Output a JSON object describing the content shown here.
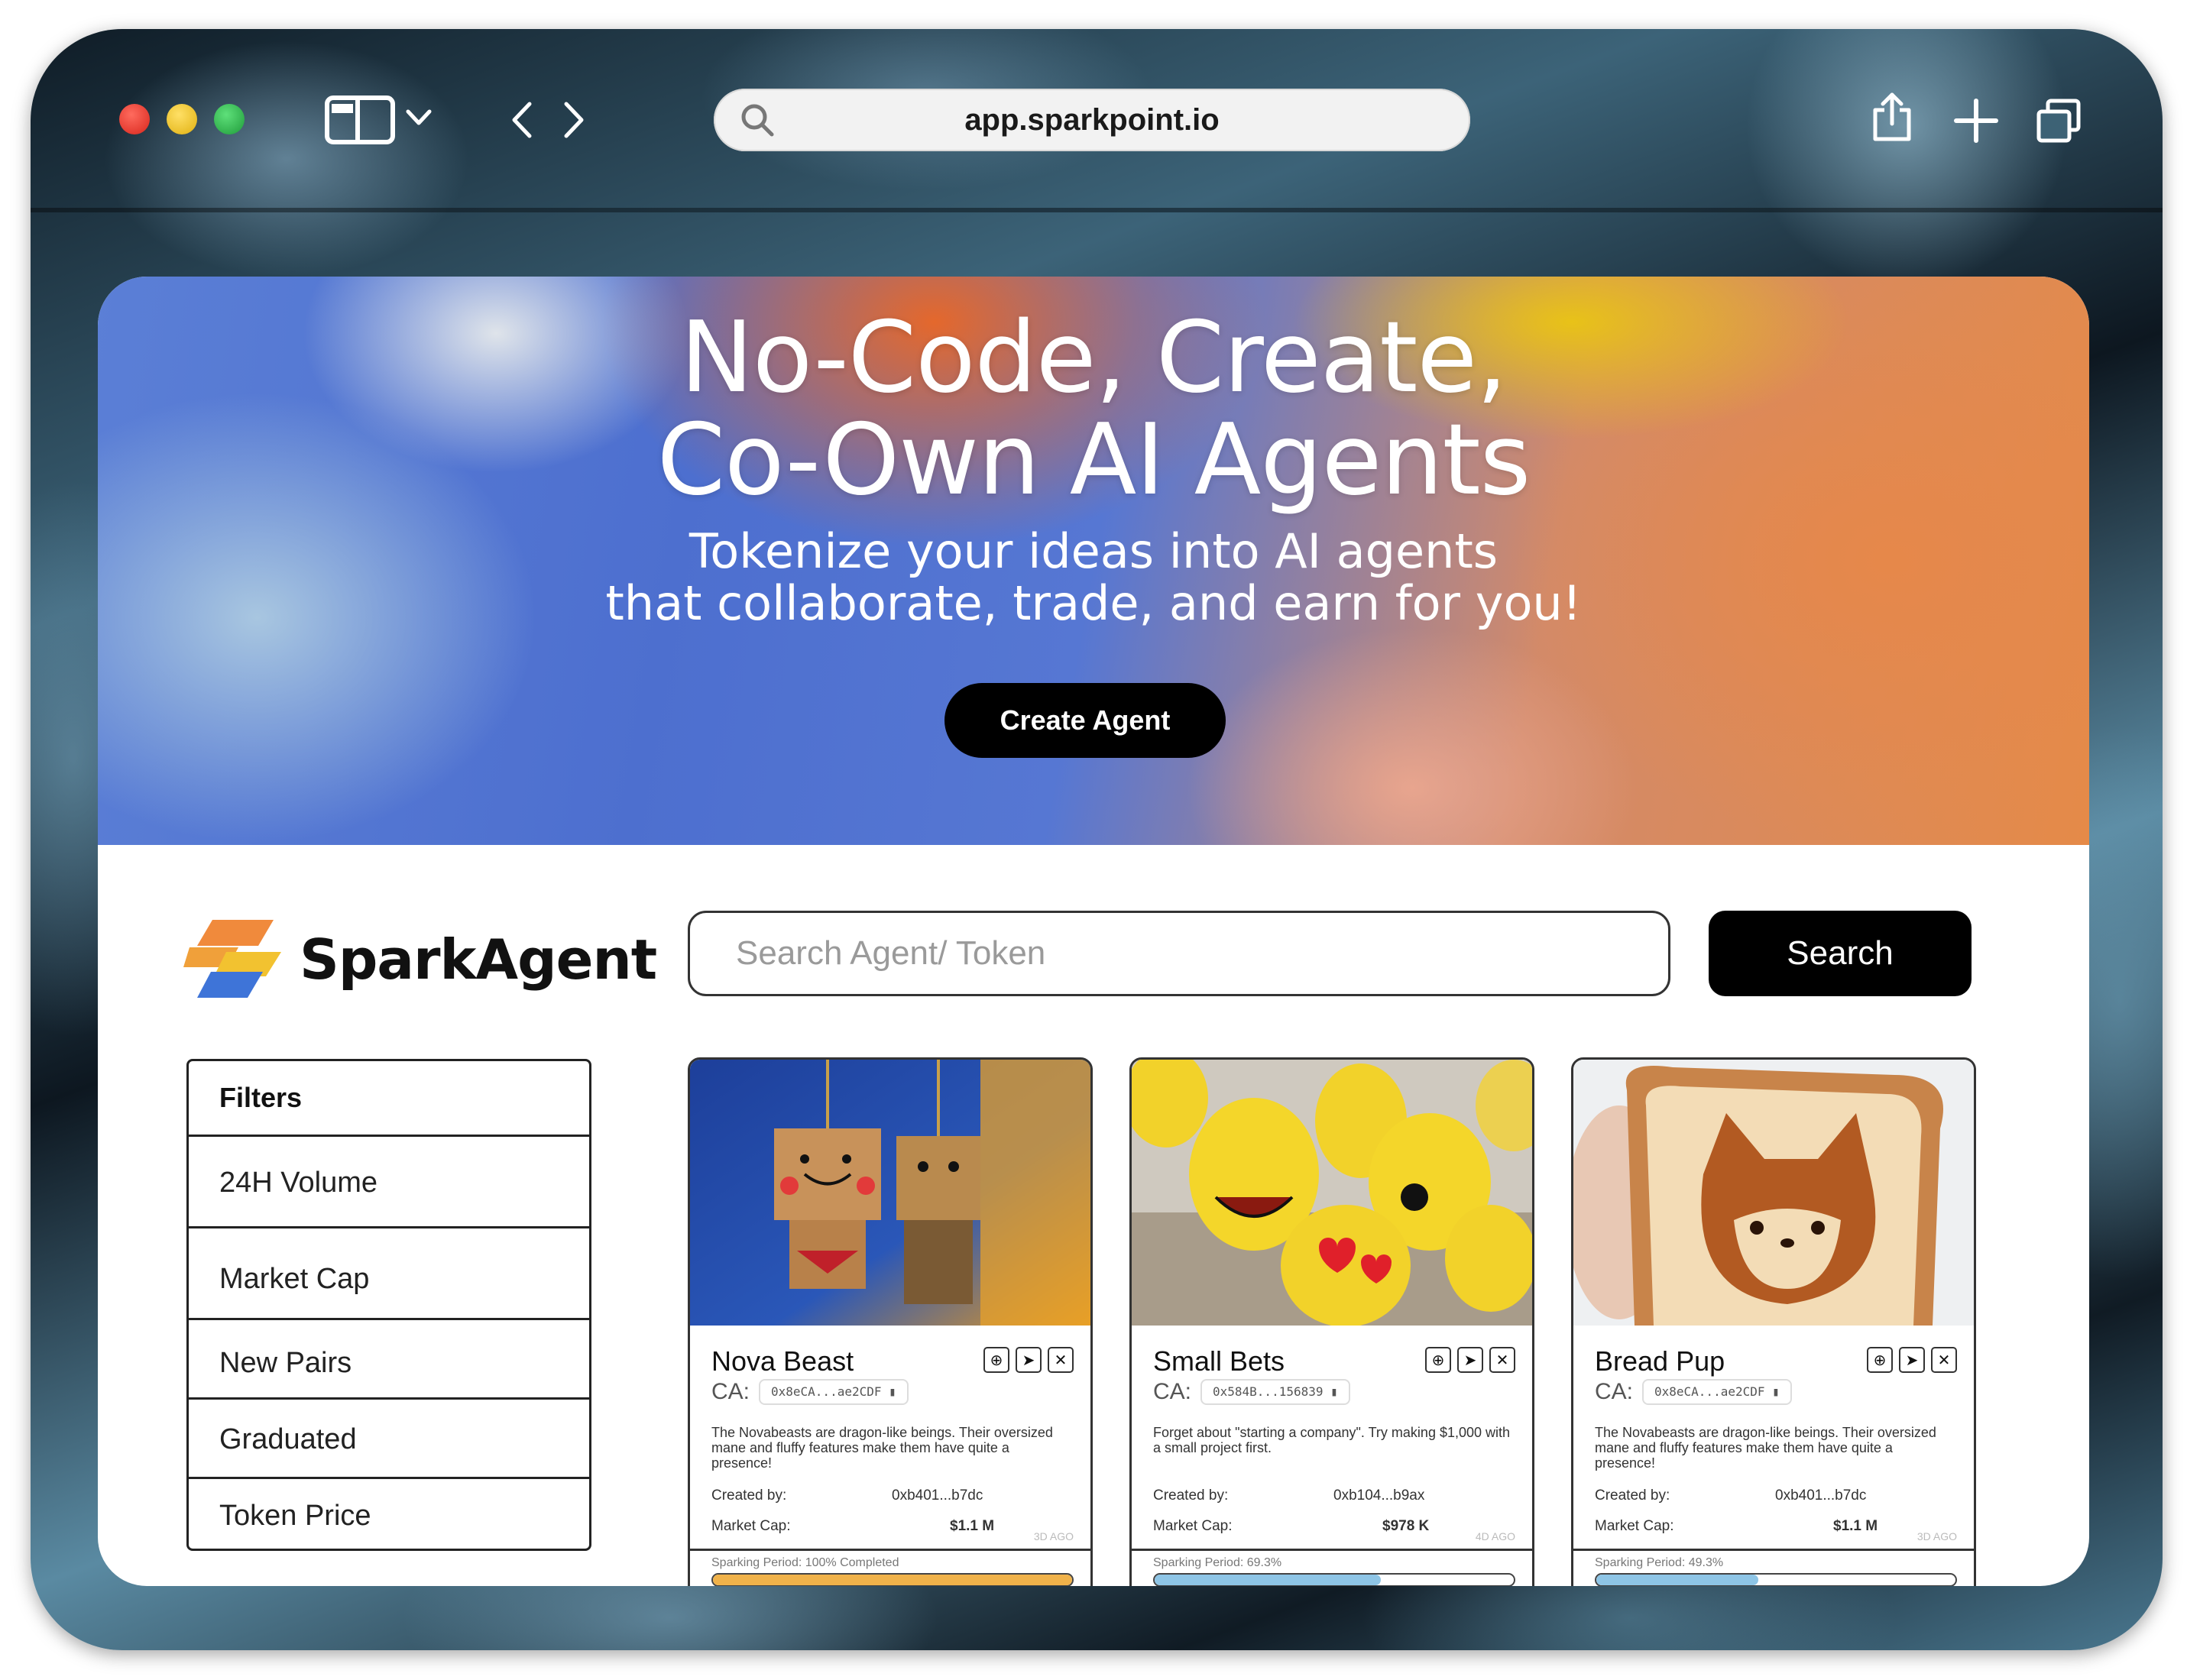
{
  "browser": {
    "url": "app.sparkpoint.io",
    "icons": [
      "sidebar-icon",
      "chevron-down-icon",
      "back-icon",
      "forward-icon",
      "search-icon",
      "share-icon",
      "plus-icon",
      "tabs-icon"
    ]
  },
  "hero": {
    "title_line1": "No-Code, Create,",
    "title_line2": "Co-Own AI Agents",
    "subtitle_line1": "Tokenize your ideas into AI agents",
    "subtitle_line2": "that collaborate, trade, and earn for you!",
    "cta_label": "Create Agent"
  },
  "brand": {
    "name": "SparkAgent"
  },
  "search": {
    "placeholder": "Search Agent/ Token",
    "button_label": "Search"
  },
  "filters": {
    "heading": "Filters",
    "items": [
      "24H Volume",
      "Market Cap",
      "New Pairs",
      "Graduated",
      "Token Price"
    ]
  },
  "cards": [
    {
      "name": "Nova Beast",
      "ca_label": "CA:",
      "ca": "0x8eCA...ae2CDF",
      "description": "The Novabeasts are dragon-like beings. Their oversized mane and fluffy features make them have quite a presence!",
      "created_by_label": "Created by:",
      "created_by": "0xb401...b7dc",
      "market_cap_label": "Market Cap:",
      "market_cap": "$1.1 M",
      "ago": "3D AGO",
      "period_text": "Sparking Period: 100% Completed",
      "progress": 1.0,
      "bar_color": "#f0b24a"
    },
    {
      "name": "Small Bets",
      "ca_label": "CA:",
      "ca": "0x584B...156839",
      "description": "Forget about \"starting a company\". Try making $1,000 with a small project first.",
      "created_by_label": "Created by:",
      "created_by": "0xb104...b9ax",
      "market_cap_label": "Market Cap:",
      "market_cap": "$978 K",
      "ago": "4D AGO",
      "period_text": "Sparking Period: 69.3%",
      "progress": 0.63,
      "bar_color": "#8ec5e6"
    },
    {
      "name": "Bread Pup",
      "ca_label": "CA:",
      "ca": "0x8eCA...ae2CDF",
      "description": "The Novabeasts are dragon-like beings. Their oversized mane and fluffy features make them have quite a presence!",
      "created_by_label": "Created by:",
      "created_by": "0xb401...b7dc",
      "market_cap_label": "Market Cap:",
      "market_cap": "$1.1 M",
      "ago": "3D AGO",
      "period_text": "Sparking Period: 49.3%",
      "progress": 0.45,
      "bar_color": "#8ec5e6"
    }
  ]
}
